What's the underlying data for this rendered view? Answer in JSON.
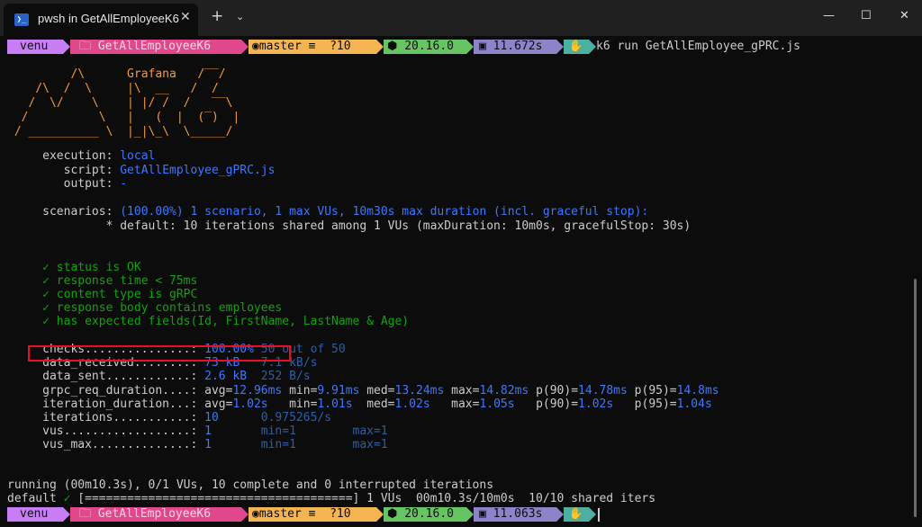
{
  "window": {
    "tab_title": "pwsh in GetAllEmployeeK6",
    "tab_icon": "❯_",
    "close_tab": "✕",
    "new_tab": "+",
    "dropdown": "⌄",
    "minimize": "—",
    "maximize": "☐",
    "close": "✕"
  },
  "prompt": {
    "user": "venu",
    "folder": "GetAllEmployeeK6",
    "branch": "master ≡  ?10",
    "node": "20.16.0",
    "time1": "11.672s",
    "time2": "11.063s",
    "command": "k6 run GetAllEmployee_gPRC.js",
    "colors": {
      "user": "#c77df3",
      "folder": "#e0488b",
      "git": "#f4b451",
      "node": "#66c463",
      "time": "#8b84c8",
      "end": "#4bb0a0"
    }
  },
  "logo": [
    "         /\\      Grafana   /‾‾/",
    "    /\\  /  \\     |\\  __   /  /",
    "   /  \\/    \\    | |/ /  /   ‾‾\\",
    "  /          \\   |   (  |  (‾)  |",
    " / __________ \\  |_|\\_\\  \\_____/"
  ],
  "options": {
    "execution_label": "     execution: ",
    "execution_value": "local",
    "script_label": "        script: ",
    "script_value": "GetAllEmployee_gPRC.js",
    "output_label": "        output: ",
    "output_value": "-",
    "scenarios_label": "     scenarios: ",
    "scenarios_value": "(100.00%) 1 scenario, 1 max VUs, 10m30s max duration (incl. graceful stop):",
    "default_line": "              * default: 10 iterations shared among 1 VUs (maxDuration: 10m0s, gracefulStop: 30s)"
  },
  "checks": [
    "     ✓ status is OK",
    "     ✓ response time < 75ms",
    "     ✓ content type is gRPC",
    "     ✓ response body contains employees",
    "     ✓ has expected fields(Id, FirstName, LastName & Age)"
  ],
  "metrics": [
    {
      "name": "     checks...............: ",
      "value": "100.00%",
      "rest": " 50 out of 50"
    },
    {
      "name": "     data_received........: ",
      "value": "73 kB  ",
      "rest": " 7.1 kB/s"
    },
    {
      "name": "     data_sent............: ",
      "value": "2.6 kB ",
      "rest": " 252 B/s"
    },
    {
      "name": "     grpc_req_duration....: ",
      "p1": "avg=",
      "v1": "12.96ms",
      "p2": " min=",
      "v2": "9.91ms",
      "p3": " med=",
      "v3": "13.24ms",
      "p4": " max=",
      "v4": "14.82ms",
      "p5": " p(90)=",
      "v5": "14.78ms",
      "p6": " p(95)=",
      "v6": "14.8ms"
    },
    {
      "name": "     iteration_duration...: ",
      "p1": "avg=",
      "v1": "1.02s  ",
      "p2": " min=",
      "v2": "1.01s ",
      "p3": " med=",
      "v3": "1.02s  ",
      "p4": " max=",
      "v4": "1.05s  ",
      "p5": " p(90)=",
      "v5": "1.02s  ",
      "p6": " p(95)=",
      "v6": "1.04s"
    },
    {
      "name": "     iterations...........: ",
      "value": "10     ",
      "rest": " 0.975265/s"
    },
    {
      "name": "     vus..................: ",
      "value": "1      ",
      "rest": " min=1        max=1"
    },
    {
      "name": "     vus_max..............: ",
      "value": "1      ",
      "rest": " min=1        max=1"
    }
  ],
  "footer": {
    "running": "running (00m10.3s), 0/1 VUs, 10 complete and 0 interrupted iterations",
    "default_label": "default ",
    "check": "✓",
    "bar": " [======================================] 1 VUs  00m10.3s/10m0s  10/10 shared iters"
  }
}
